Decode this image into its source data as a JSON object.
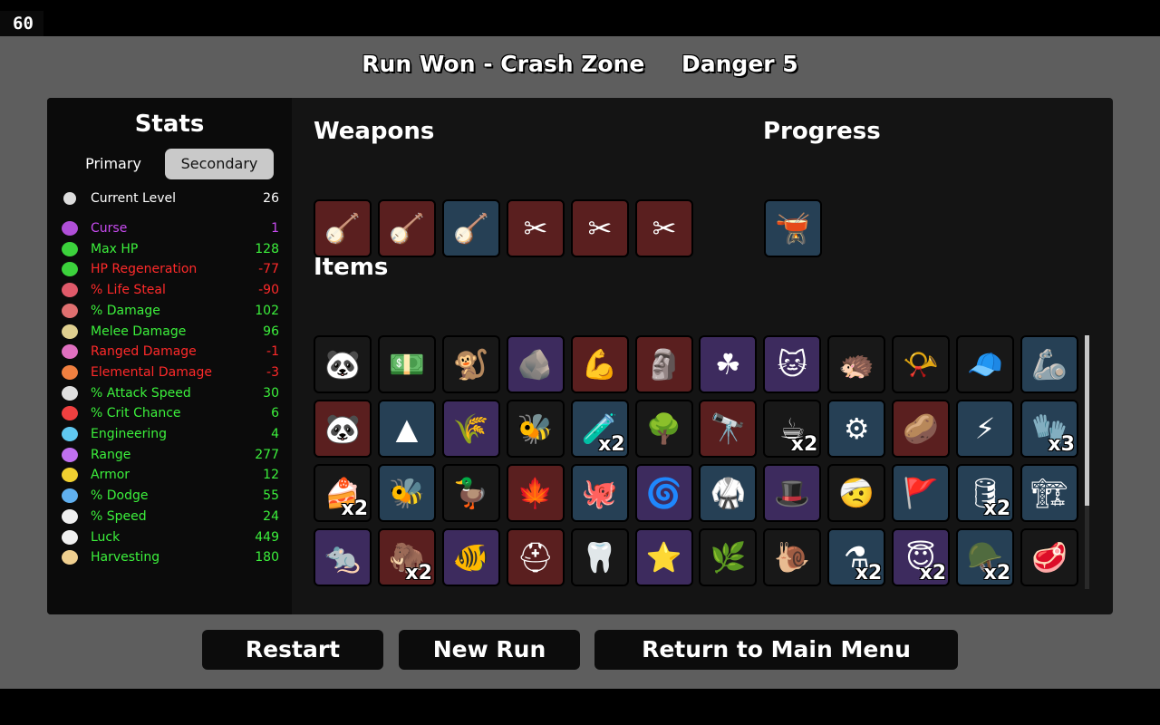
{
  "fps": "60",
  "header": {
    "run_result": "Run Won - Crash Zone",
    "danger": "Danger 5"
  },
  "stats": {
    "title": "Stats",
    "tabs": {
      "primary": "Primary",
      "secondary": "Secondary"
    },
    "current_level": {
      "label": "Current Level",
      "value": "26"
    },
    "rows": [
      {
        "label": "Curse",
        "value": "1",
        "color": "#c84bf0",
        "icon": "eye-icon",
        "icolor": "#b04fd8"
      },
      {
        "label": "Max HP",
        "value": "128",
        "color": "#3cf03c",
        "icon": "heart-icon",
        "icolor": "#3cd23c"
      },
      {
        "label": "HP Regeneration",
        "value": "-77",
        "color": "#ff2a2a",
        "icon": "heart-plus-icon",
        "icolor": "#3cd23c"
      },
      {
        "label": "% Life Steal",
        "value": "-90",
        "color": "#ff2a2a",
        "icon": "fangs-icon",
        "icolor": "#e05a6a"
      },
      {
        "label": "% Damage",
        "value": "102",
        "color": "#3cf03c",
        "icon": "fist-icon",
        "icolor": "#e07070"
      },
      {
        "label": "Melee Damage",
        "value": "96",
        "color": "#3cf03c",
        "icon": "sword-icon",
        "icolor": "#e0d090"
      },
      {
        "label": "Ranged Damage",
        "value": "-1",
        "color": "#ff2a2a",
        "icon": "bow-icon",
        "icolor": "#e070c0"
      },
      {
        "label": "Elemental Damage",
        "value": "-3",
        "color": "#ff2a2a",
        "icon": "flame-icon",
        "icolor": "#f08040"
      },
      {
        "label": "% Attack Speed",
        "value": "30",
        "color": "#3cf03c",
        "icon": "hourglass-icon",
        "icolor": "#e0e0e0"
      },
      {
        "label": "% Crit Chance",
        "value": "6",
        "color": "#3cf03c",
        "icon": "crit-burst-icon",
        "icolor": "#f04040"
      },
      {
        "label": "Engineering",
        "value": "4",
        "color": "#3cf03c",
        "icon": "wrench-cross-icon",
        "icolor": "#60c8f0"
      },
      {
        "label": "Range",
        "value": "277",
        "color": "#3cf03c",
        "icon": "range-waves-icon",
        "icolor": "#c070f0"
      },
      {
        "label": "Armor",
        "value": "12",
        "color": "#3cf03c",
        "icon": "shield-icon",
        "icolor": "#f0d030"
      },
      {
        "label": "% Dodge",
        "value": "55",
        "color": "#3cf03c",
        "icon": "dodge-wind-icon",
        "icolor": "#60b0f0"
      },
      {
        "label": "% Speed",
        "value": "24",
        "color": "#3cf03c",
        "icon": "boot-icon",
        "icolor": "#f0f0f0"
      },
      {
        "label": "Luck",
        "value": "449",
        "color": "#3cf03c",
        "icon": "dice-icon",
        "icolor": "#f0f0f0"
      },
      {
        "label": "Harvesting",
        "value": "180",
        "color": "#3cf03c",
        "icon": "wheat-icon",
        "icolor": "#f0d090"
      }
    ]
  },
  "weapons": {
    "title": "Weapons",
    "slots": [
      {
        "icon": "lute-icon",
        "glyph": "🪕",
        "tier": "t4"
      },
      {
        "icon": "lute-icon",
        "glyph": "🪕",
        "tier": "t4"
      },
      {
        "icon": "lute-icon",
        "glyph": "🪕",
        "tier": "t2"
      },
      {
        "icon": "pruner-icon",
        "glyph": "✂",
        "tier": "t4"
      },
      {
        "icon": "pruner-icon",
        "glyph": "✂",
        "tier": "t4"
      },
      {
        "icon": "pruner-icon",
        "glyph": "✂",
        "tier": "t4"
      }
    ]
  },
  "progress": {
    "title": "Progress",
    "slots": [
      {
        "icon": "cauldron-icon",
        "glyph": "🫕",
        "tier": "t2"
      }
    ]
  },
  "items": {
    "title": "Items",
    "slots": [
      {
        "icon": "panda-mask-icon",
        "glyph": "🐼",
        "tier": "t1",
        "count": ""
      },
      {
        "icon": "cash-bill-icon",
        "glyph": "💵",
        "tier": "t1",
        "count": ""
      },
      {
        "icon": "monkey-icon",
        "glyph": "🐒",
        "tier": "t1",
        "count": ""
      },
      {
        "icon": "stone-icon",
        "glyph": "🪨",
        "tier": "t3",
        "count": ""
      },
      {
        "icon": "arm-icon",
        "glyph": "💪",
        "tier": "t4",
        "count": ""
      },
      {
        "icon": "statue-head-icon",
        "glyph": "🗿",
        "tier": "t4",
        "count": ""
      },
      {
        "icon": "clover-icon",
        "glyph": "☘",
        "tier": "t3",
        "count": ""
      },
      {
        "icon": "cat-plush-icon",
        "glyph": "🐱",
        "tier": "t3",
        "count": ""
      },
      {
        "icon": "hedgehog-icon",
        "glyph": "🦔",
        "tier": "t1",
        "count": ""
      },
      {
        "icon": "whistle-icon",
        "glyph": "📯",
        "tier": "t1",
        "count": ""
      },
      {
        "icon": "propeller-hat-icon",
        "glyph": "🧢",
        "tier": "t1",
        "count": ""
      },
      {
        "icon": "robot-arm-icon",
        "glyph": "🦾",
        "tier": "t2",
        "count": ""
      },
      {
        "icon": "panda-icon",
        "glyph": "🐼",
        "tier": "t4",
        "count": ""
      },
      {
        "icon": "bullet-icon",
        "glyph": "▲",
        "tier": "t2",
        "count": ""
      },
      {
        "icon": "wheat-icon",
        "glyph": "🌾",
        "tier": "t3",
        "count": ""
      },
      {
        "icon": "bee-icon",
        "glyph": "🐝",
        "tier": "t1",
        "count": ""
      },
      {
        "icon": "potion-icon",
        "glyph": "🧪",
        "tier": "t2",
        "count": "x2"
      },
      {
        "icon": "tree-icon",
        "glyph": "🌳",
        "tier": "t1",
        "count": ""
      },
      {
        "icon": "binoculars-icon",
        "glyph": "🔭",
        "tier": "t4",
        "count": ""
      },
      {
        "icon": "coffee-cup-icon",
        "glyph": "☕",
        "tier": "t1",
        "count": "x2"
      },
      {
        "icon": "turret-icon",
        "glyph": "⚙",
        "tier": "t2",
        "count": ""
      },
      {
        "icon": "potato-icon",
        "glyph": "🥔",
        "tier": "t4",
        "count": ""
      },
      {
        "icon": "lightning-claw-icon",
        "glyph": "⚡",
        "tier": "t2",
        "count": ""
      },
      {
        "icon": "glove-icon",
        "glyph": "🧤",
        "tier": "t2",
        "count": "x3"
      },
      {
        "icon": "cake-icon",
        "glyph": "🍰",
        "tier": "t1",
        "count": "x2"
      },
      {
        "icon": "wasp-icon",
        "glyph": "🐝",
        "tier": "t2",
        "count": ""
      },
      {
        "icon": "duck-icon",
        "glyph": "🦆",
        "tier": "t1",
        "count": ""
      },
      {
        "icon": "rainbow-leaf-icon",
        "glyph": "🍁",
        "tier": "t4",
        "count": ""
      },
      {
        "icon": "octopus-icon",
        "glyph": "🐙",
        "tier": "t2",
        "count": ""
      },
      {
        "icon": "spring-icon",
        "glyph": "🌀",
        "tier": "t3",
        "count": ""
      },
      {
        "icon": "black-belt-icon",
        "glyph": "🥋",
        "tier": "t2",
        "count": ""
      },
      {
        "icon": "bowler-hat-icon",
        "glyph": "🎩",
        "tier": "t3",
        "count": ""
      },
      {
        "icon": "bandaged-head-icon",
        "glyph": "🤕",
        "tier": "t1",
        "count": ""
      },
      {
        "icon": "torn-flag-icon",
        "glyph": "🚩",
        "tier": "t2",
        "count": ""
      },
      {
        "icon": "barrel-icon",
        "glyph": "🛢",
        "tier": "t2",
        "count": "x2"
      },
      {
        "icon": "crane-arm-icon",
        "glyph": "🏗",
        "tier": "t2",
        "count": ""
      },
      {
        "icon": "rat-icon",
        "glyph": "🐀",
        "tier": "t3",
        "count": ""
      },
      {
        "icon": "mammoth-icon",
        "glyph": "🦣",
        "tier": "t4",
        "count": "x2"
      },
      {
        "icon": "goldfish-icon",
        "glyph": "🐠",
        "tier": "t3",
        "count": ""
      },
      {
        "icon": "dark-helmet-icon",
        "glyph": "⛑",
        "tier": "t4",
        "count": ""
      },
      {
        "icon": "tooth-icon",
        "glyph": "🦷",
        "tier": "t1",
        "count": ""
      },
      {
        "icon": "starfish-icon",
        "glyph": "⭐",
        "tier": "t3",
        "count": ""
      },
      {
        "icon": "seed-bag-icon",
        "glyph": "🌿",
        "tier": "t1",
        "count": ""
      },
      {
        "icon": "snail-icon",
        "glyph": "🐌",
        "tier": "t1",
        "count": ""
      },
      {
        "icon": "flask-icon",
        "glyph": "⚗",
        "tier": "t2",
        "count": "x2"
      },
      {
        "icon": "halo-drone-icon",
        "glyph": "😇",
        "tier": "t3",
        "count": "x2"
      },
      {
        "icon": "helmet-drone-icon",
        "glyph": "🪖",
        "tier": "t2",
        "count": "x2"
      },
      {
        "icon": "meat-chunk-icon",
        "glyph": "🥩",
        "tier": "t1",
        "count": ""
      }
    ]
  },
  "buttons": {
    "restart": "Restart",
    "new_run": "New Run",
    "main_menu": "Return to Main Menu"
  }
}
